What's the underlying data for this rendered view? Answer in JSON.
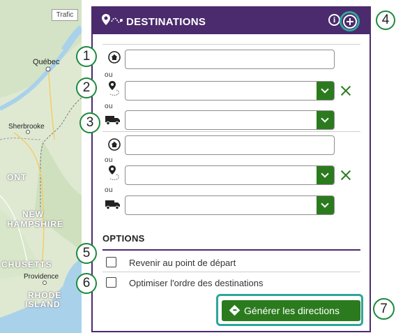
{
  "map": {
    "traffic_button": "Trafic",
    "labels": {
      "quebec": "Québec",
      "sherbrooke": "Sherbrooke",
      "ont": "ONT",
      "new": "NEW",
      "hampshire": "HAMPSHIRE",
      "chusetts": "CHUSETTS",
      "providence": "Providence",
      "rhode": "RHODE",
      "island": "ISLAND"
    }
  },
  "panel": {
    "title": "DESTINATIONS",
    "info_icon": "info-icon",
    "add_icon": "plus-circle-icon",
    "header_icon": "route-pin-icon"
  },
  "destinations": [
    {
      "address_value": "",
      "location_select": "",
      "vehicle_select": ""
    },
    {
      "address_value": "",
      "location_select": "",
      "vehicle_select": ""
    }
  ],
  "separator_word": "ou",
  "options": {
    "title": "OPTIONS",
    "return_to_start": "Revenir au point de départ",
    "optimize_order": "Optimiser l'ordre des destinations",
    "return_checked": false,
    "optimize_checked": false
  },
  "generate_button": "Générer les directions",
  "callouts": [
    "1",
    "2",
    "3",
    "4",
    "5",
    "6",
    "7"
  ],
  "colors": {
    "header": "#4b2a6d",
    "accent_green": "#2b7b1e",
    "highlight_teal": "#2fa59a"
  }
}
